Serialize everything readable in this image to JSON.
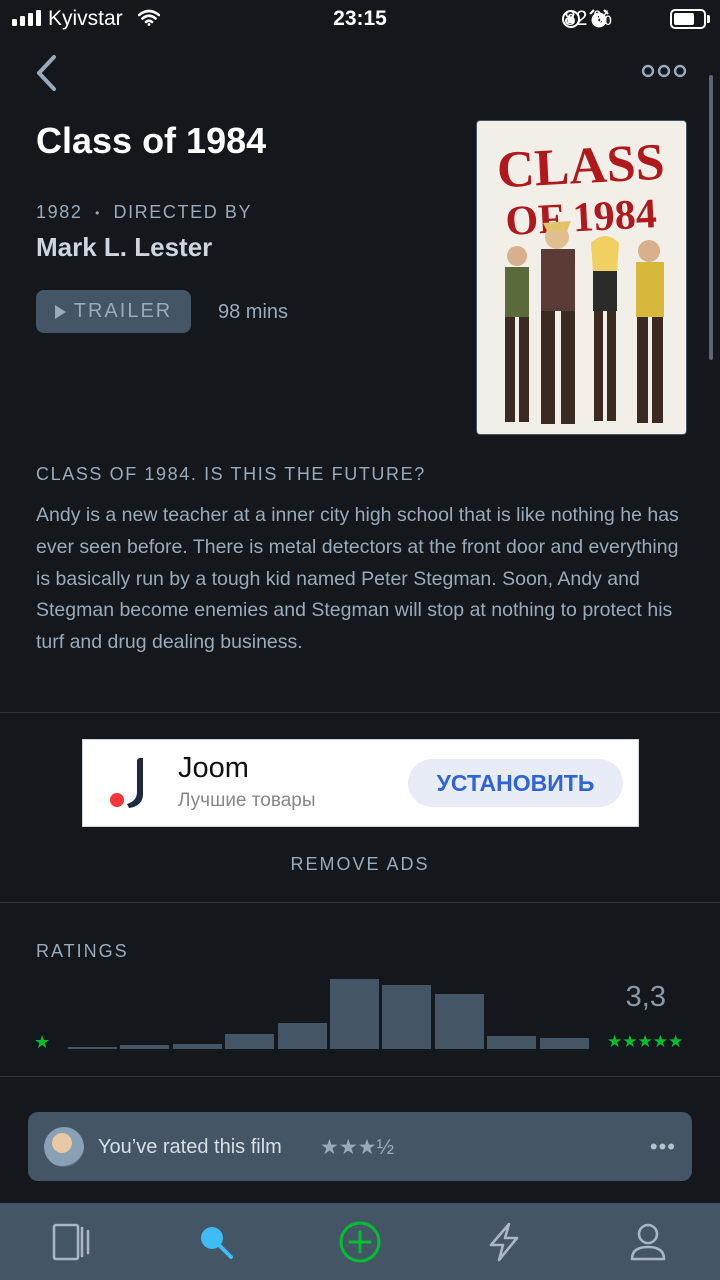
{
  "status_bar": {
    "carrier": "Kyivstar",
    "time": "23:15",
    "battery": "82 %",
    "battery_level": 0.82
  },
  "nav": {
    "back_icon": "chevron-left-icon",
    "more_icon": "more-horizontal-icon"
  },
  "film": {
    "title": "Class of 1984",
    "year": "1982",
    "directed_by": "DIRECTED BY",
    "director": "Mark L. Lester",
    "trailer_label": "TRAILER",
    "runtime": "98 mins",
    "tagline": "CLASS OF 1984. IS THIS THE FUTURE?",
    "synopsis": "Andy is a new teacher at a inner city high school that is like nothing he has ever seen before. There is metal detectors at the front door and everything is basically run by a tough kid named Peter Stegman. Soon, Andy and Stegman become enemies and Stegman will stop at nothing to protect his turf and drug dealing business.",
    "poster_text": [
      "CLASS",
      "OF 1984"
    ]
  },
  "ad": {
    "name": "Joom",
    "subtitle": "Лучшие товары",
    "cta": "УСТАНОВИТЬ",
    "remove_ads": "REMOVE ADS"
  },
  "ratings": {
    "label": "RATINGS",
    "average": "3,3",
    "low_star": "★",
    "high_stars": "★★★★★",
    "histogram": [
      0.03,
      0.05,
      0.07,
      0.22,
      0.37,
      1.0,
      0.91,
      0.79,
      0.18,
      0.15
    ]
  },
  "user_rating": {
    "text": "You’ve rated this film",
    "stars": "★★★½",
    "more": "•••"
  },
  "tabbar": {
    "items": [
      "films-icon",
      "search-icon",
      "add-icon",
      "activity-icon",
      "profile-icon"
    ],
    "active": "search-icon"
  },
  "colors": {
    "background": "#14181c",
    "accent_green": "#00c030",
    "accent_blue": "#40bcf4",
    "panel": "#445566",
    "muted_text": "#99aabb"
  }
}
